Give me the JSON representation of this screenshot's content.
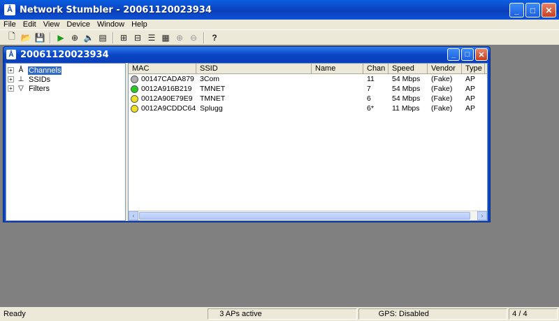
{
  "window": {
    "title": "Network Stumbler - 20061120023934",
    "app_icon": "antenna-icon",
    "buttons": {
      "minimize": "_",
      "maximize": "□",
      "close": "✕"
    }
  },
  "menu": [
    "File",
    "Edit",
    "View",
    "Device",
    "Window",
    "Help"
  ],
  "toolbar": {
    "buttons": [
      "new-file-icon",
      "open-folder-icon",
      "save-icon",
      "play-icon",
      "scan-options-icon",
      "sound-icon",
      "properties-icon",
      "large-icons-icon",
      "small-icons-icon",
      "list-icon",
      "details-icon",
      "zoom-in-icon",
      "zoom-out-icon",
      "help-icon"
    ],
    "glyphs": [
      "🗋",
      "📂",
      "💾",
      "▶",
      "⊕",
      "🔈",
      "▤",
      "⊞",
      "⊟",
      "☰",
      "▦",
      "⊕",
      "⊖",
      "?"
    ]
  },
  "child_window": {
    "title": "20061120023934"
  },
  "tree": [
    {
      "label": "Channels",
      "icon": "antenna-icon",
      "glyph": "Å",
      "expander": "+",
      "selected": true
    },
    {
      "label": "SSIDs",
      "icon": "network-icon",
      "glyph": "⊥",
      "expander": "+",
      "selected": false
    },
    {
      "label": "Filters",
      "icon": "filter-icon",
      "glyph": "▽",
      "expander": "+",
      "selected": false
    }
  ],
  "columns": [
    "MAC",
    "SSID",
    "Name",
    "Chan",
    "Speed",
    "Vendor",
    "Type"
  ],
  "rows": [
    {
      "status_color": "#b0b0b0",
      "mac": "00147CADA879",
      "ssid": "3Com",
      "name": "",
      "chan": "11",
      "speed": "54 Mbps",
      "vendor": "(Fake)",
      "type": "AP"
    },
    {
      "status_color": "#22cc22",
      "mac": "0012A916B219",
      "ssid": "TMNET",
      "name": "",
      "chan": "7",
      "speed": "54 Mbps",
      "vendor": "(Fake)",
      "type": "AP"
    },
    {
      "status_color": "#f0e020",
      "mac": "0012A90E79E9",
      "ssid": "TMNET",
      "name": "",
      "chan": "6",
      "speed": "54 Mbps",
      "vendor": "(Fake)",
      "type": "AP"
    },
    {
      "status_color": "#f0e020",
      "mac": "0012A9CDDC64",
      "ssid": "Splugg",
      "name": "",
      "chan": "6*",
      "speed": "11 Mbps",
      "vendor": "(Fake)",
      "type": "AP"
    }
  ],
  "scrollbar": {
    "left": "‹",
    "right": "›"
  },
  "status": {
    "ready": "Ready",
    "aps": "3 APs active",
    "gps": "GPS: Disabled",
    "count": "4 / 4"
  }
}
